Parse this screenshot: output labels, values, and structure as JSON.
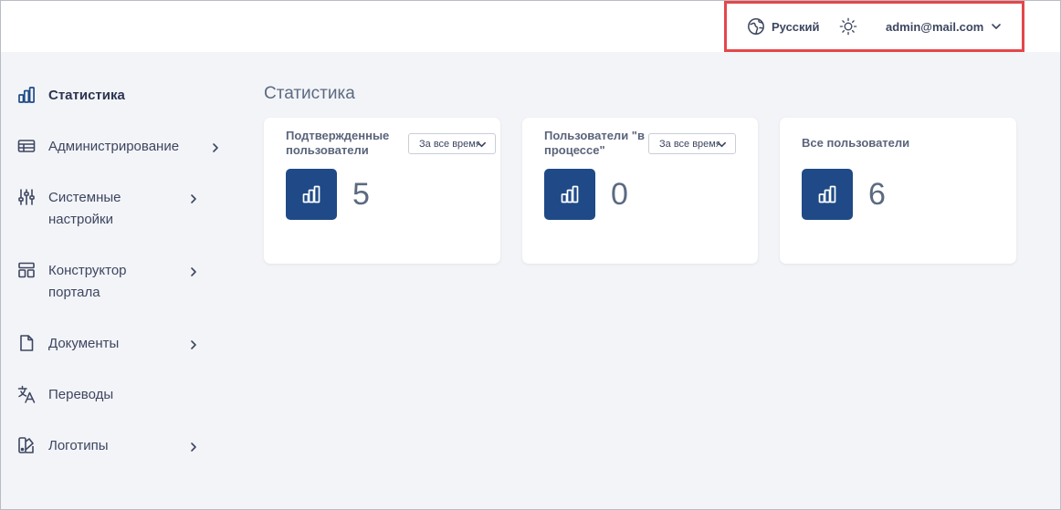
{
  "header": {
    "language_label": "Русский",
    "language_icon": "globe-icon",
    "theme_icon": "sun-icon",
    "user_email": "admin@mail.com",
    "user_menu_icon": "chevron-down-icon",
    "highlight_color": "#e4474a"
  },
  "sidebar": {
    "items": [
      {
        "label": "Статистика",
        "icon": "bar-chart-icon",
        "active": true,
        "has_submenu": false
      },
      {
        "label": "Администрирование",
        "icon": "table-icon",
        "active": false,
        "has_submenu": true
      },
      {
        "label": "Системные настройки",
        "icon": "sliders-icon",
        "active": false,
        "has_submenu": true
      },
      {
        "label": "Конструктор портала",
        "icon": "layout-icon",
        "active": false,
        "has_submenu": true
      },
      {
        "label": "Документы",
        "icon": "document-icon",
        "active": false,
        "has_submenu": true
      },
      {
        "label": "Переводы",
        "icon": "translate-icon",
        "active": false,
        "has_submenu": false
      },
      {
        "label": "Логотипы",
        "icon": "palette-icon",
        "active": false,
        "has_submenu": true
      }
    ]
  },
  "main": {
    "page_title": "Статистика",
    "cards": [
      {
        "title": "Подтвержденные пользователи",
        "filter_value": "За все время",
        "value": "5",
        "icon": "bar-chart-icon"
      },
      {
        "title": "Пользователи \"в процессе\"",
        "filter_value": "За все время",
        "value": "0",
        "icon": "bar-chart-icon"
      },
      {
        "title": "Все пользователи",
        "value": "6",
        "icon": "bar-chart-icon"
      }
    ]
  },
  "colors": {
    "accent": "#1f4a87",
    "background": "#f3f4f8",
    "card": "#ffffff",
    "text": "#3d4660"
  }
}
